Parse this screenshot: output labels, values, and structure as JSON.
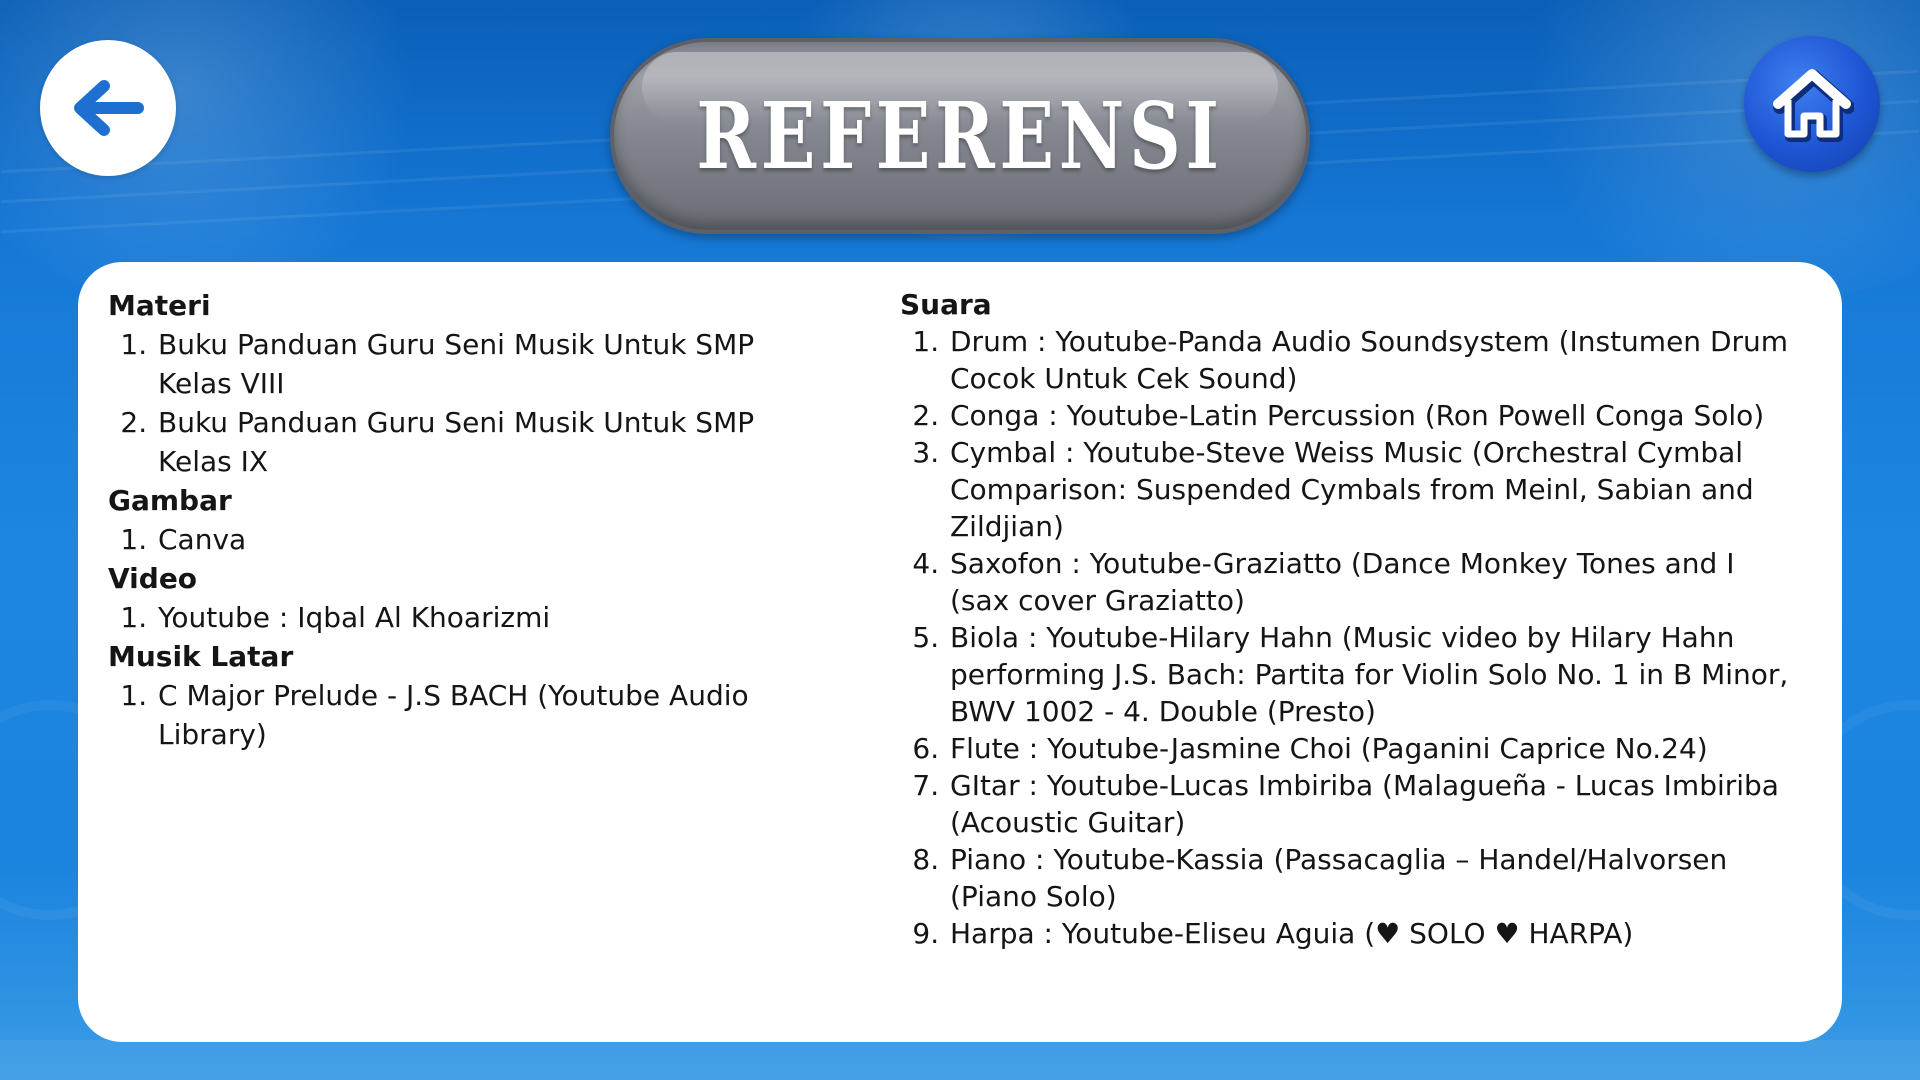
{
  "title": "REFERENSI",
  "nav": {
    "back_icon": "arrow-left-icon",
    "home_icon": "home-icon"
  },
  "colors": {
    "background": "#1c86e0",
    "pill": "#84878f",
    "home_button": "#1d55d4",
    "panel": "#ffffff",
    "text": "#151515"
  },
  "left_column": {
    "sections": [
      {
        "heading": "Materi",
        "items": [
          "Buku Panduan Guru Seni Musik Untuk SMP Kelas VIII",
          "Buku Panduan Guru Seni Musik Untuk SMP Kelas IX"
        ]
      },
      {
        "heading": "Gambar",
        "items": [
          "Canva"
        ]
      },
      {
        "heading": "Video",
        "items": [
          "Youtube : Iqbal Al Khoarizmi"
        ]
      },
      {
        "heading": "Musik Latar",
        "items": [
          "C Major Prelude - J.S BACH (Youtube Audio Library)"
        ]
      }
    ]
  },
  "right_column": {
    "heading": "Suara",
    "items": [
      "Drum : Youtube-Panda Audio Soundsystem (Instumen Drum Cocok Untuk Cek Sound)",
      "Conga : Youtube-Latin Percussion (Ron Powell Conga Solo)",
      "Cymbal : Youtube-Steve Weiss Music (Orchestral Cymbal Comparison: Suspended Cymbals from Meinl, Sabian and Zildjian)",
      "Saxofon : Youtube-Graziatto (Dance Monkey Tones and I (sax cover Graziatto)",
      "Biola : Youtube-Hilary Hahn (Music video by Hilary Hahn performing J.S. Bach: Partita for Violin Solo No. 1 in B Minor, BWV 1002 - 4. Double (Presto)",
      "Flute : Youtube-Jasmine Choi (Paganini Caprice No.24)",
      "GItar : Youtube-Lucas Imbiriba (Malagueña - Lucas Imbiriba (Acoustic Guitar)",
      "Piano : Youtube-Kassia (Passacaglia – Handel/Halvorsen (Piano Solo)",
      "Harpa : Youtube-Eliseu Aguia (♥ SOLO ♥ HARPA)"
    ]
  }
}
